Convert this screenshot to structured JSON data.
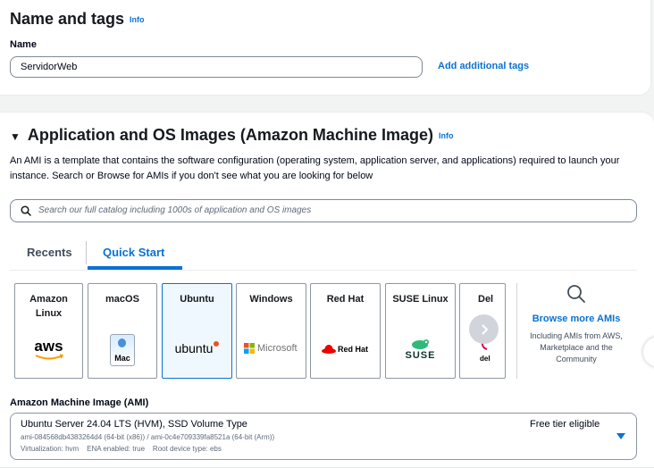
{
  "name_tags": {
    "title": "Name and tags",
    "info": "Info",
    "name_label": "Name",
    "name_value": "ServidorWeb",
    "add_tags_link": "Add additional tags"
  },
  "app_os": {
    "title": "Application and OS Images (Amazon Machine Image)",
    "info": "Info",
    "description": "An AMI is a template that contains the software configuration (operating system, application server, and applications) required to launch your instance. Search or Browse for AMIs if you don't see what you are looking for below",
    "search_placeholder": "Search our full catalog including 1000s of application and OS images",
    "tabs": [
      {
        "label": "Recents",
        "active": false
      },
      {
        "label": "Quick Start",
        "active": true
      }
    ],
    "tiles": [
      {
        "title": "Amazon Linux",
        "logo": "aws",
        "icon": "aws-logo-icon"
      },
      {
        "title": "macOS",
        "logo": "Mac",
        "icon": "mac-logo-icon"
      },
      {
        "title": "Ubuntu",
        "logo": "ubuntu",
        "icon": "ubuntu-logo-icon",
        "selected": true
      },
      {
        "title": "Windows",
        "logo": "Microsoft",
        "icon": "microsoft-logo-icon"
      },
      {
        "title": "Red Hat",
        "logo": "Red Hat",
        "icon": "redhat-logo-icon"
      },
      {
        "title": "SUSE Linux",
        "logo": "SUSE",
        "icon": "suse-logo-icon"
      },
      {
        "title": "Del",
        "logo": "del",
        "icon": "debian-logo-icon"
      }
    ],
    "browse": {
      "link": "Browse more AMIs",
      "subtext": "Including AMIs from AWS, Marketplace and the Community"
    },
    "ami_label": "Amazon Machine Image (AMI)",
    "ami": {
      "name": "Ubuntu Server 24.04 LTS (HVM), SSD Volume Type",
      "ids": "ami-084568db4383264d4 (64-bit (x86)) / ami-0c4e709339fa8521a (64-bit (Arm))",
      "details": "Virtualization: hvm    ENA enabled: true    Root device type: ebs",
      "badge": "Free tier eligible"
    }
  },
  "colors": {
    "accent": "#0972d3",
    "border": "#8c96a3",
    "text": "#16191f"
  }
}
